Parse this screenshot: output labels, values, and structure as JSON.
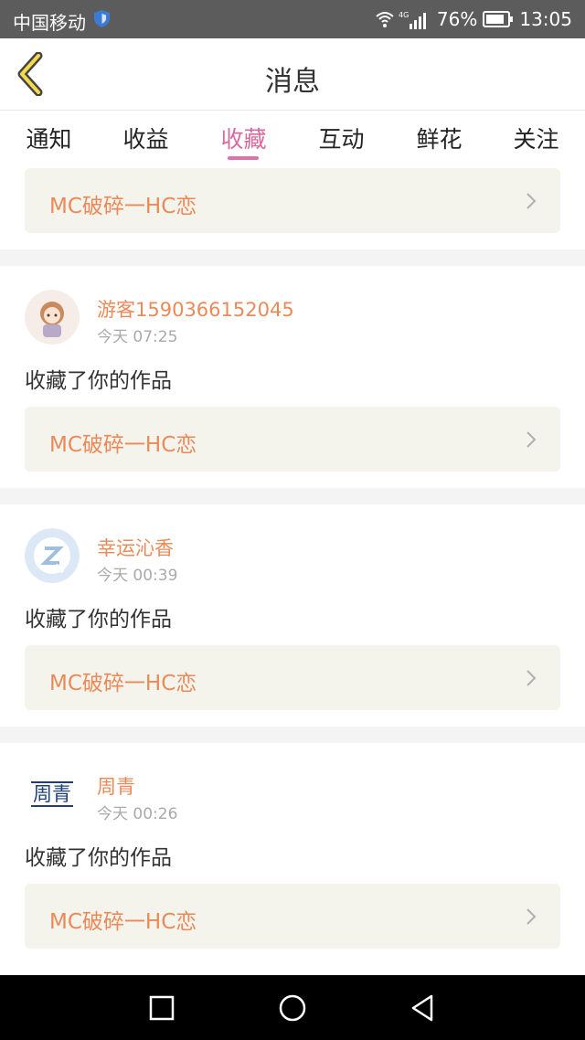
{
  "status_bar": {
    "carrier": "中国移动",
    "network": "4G",
    "battery": "76%",
    "time": "13:05"
  },
  "header": {
    "title": "消息"
  },
  "tabs": [
    {
      "label": "通知"
    },
    {
      "label": "收益"
    },
    {
      "label": "收藏"
    },
    {
      "label": "互动"
    },
    {
      "label": "鲜花"
    },
    {
      "label": "关注"
    }
  ],
  "active_tab": "收藏",
  "top_work": "MC破碎一HC恋",
  "items": [
    {
      "user": "游客1590366152045",
      "time": "今天 07:25",
      "action": "收藏了你的作品",
      "work": "MC破碎一HC恋"
    },
    {
      "user": "幸运沁香",
      "time": "今天 00:39",
      "action": "收藏了你的作品",
      "work": "MC破碎一HC恋"
    },
    {
      "user": "周青",
      "time": "今天 00:26",
      "action": "收藏了你的作品",
      "work": "MC破碎一HC恋",
      "avatar_text": "周青"
    }
  ],
  "colors": {
    "accent_pink": "#d96aa0",
    "orange_text": "#ea8a58",
    "work_bar_bg": "#f4f3ec"
  }
}
